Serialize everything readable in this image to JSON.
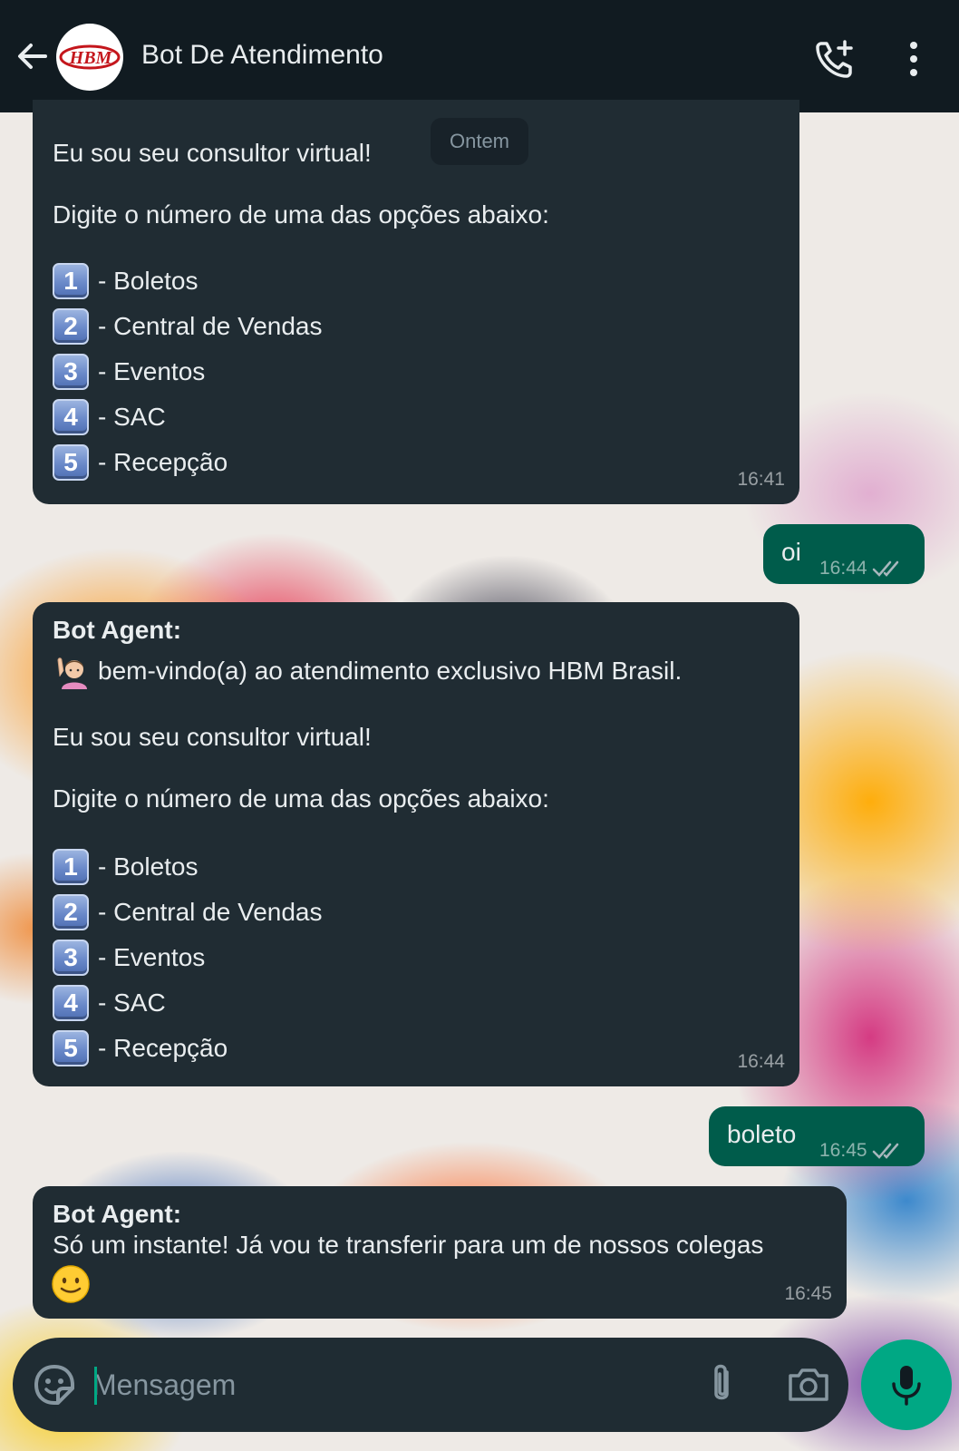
{
  "header": {
    "title": "Bot De Atendimento",
    "avatar_text": "HBM",
    "back_icon": "arrow-left-icon",
    "call_icon": "phone-add-icon",
    "menu_icon": "more-vertical-icon"
  },
  "date_separator": "Ontem",
  "messages": [
    {
      "direction": "incoming",
      "lines": [
        "Eu sou seu consultor virtual!",
        "Digite o número de uma das opções abaixo:"
      ],
      "options": [
        {
          "key": "1",
          "label": "- Boletos"
        },
        {
          "key": "2",
          "label": "- Central de Vendas"
        },
        {
          "key": "3",
          "label": "- Eventos"
        },
        {
          "key": "4",
          "label": "- SAC"
        },
        {
          "key": "5",
          "label": "- Recepção"
        }
      ],
      "time": "16:41"
    },
    {
      "direction": "outgoing",
      "text": "oi",
      "time": "16:44",
      "status": "read"
    },
    {
      "direction": "incoming",
      "sender": "Bot Agent:",
      "emoji": "person-raising-hand",
      "lines": [
        "bem-vindo(a) ao atendimento exclusivo HBM Brasil.",
        "Eu sou seu consultor virtual!",
        "Digite o número de uma das opções abaixo:"
      ],
      "options": [
        {
          "key": "1",
          "label": "- Boletos"
        },
        {
          "key": "2",
          "label": "- Central de Vendas"
        },
        {
          "key": "3",
          "label": "- Eventos"
        },
        {
          "key": "4",
          "label": "- SAC"
        },
        {
          "key": "5",
          "label": "- Recepção"
        }
      ],
      "time": "16:44"
    },
    {
      "direction": "outgoing",
      "text": "boleto",
      "time": "16:45",
      "status": "read"
    },
    {
      "direction": "incoming",
      "sender": "Bot Agent:",
      "lines": [
        "Só um instante! Já vou te transferir para um de nossos colegas"
      ],
      "emoji": "slightly-smiling-face",
      "time": "16:45"
    }
  ],
  "composer": {
    "placeholder": "Mensagem",
    "value": "",
    "emoji_icon": "sticker-icon",
    "attach_icon": "paperclip-icon",
    "camera_icon": "camera-icon",
    "mic_icon": "mic-icon"
  },
  "colors": {
    "header_bg": "#111b21",
    "incoming_bubble": "#202c33",
    "outgoing_bubble": "#005c4b",
    "accent": "#00a884",
    "read_ticks": "#a8b7bd"
  }
}
